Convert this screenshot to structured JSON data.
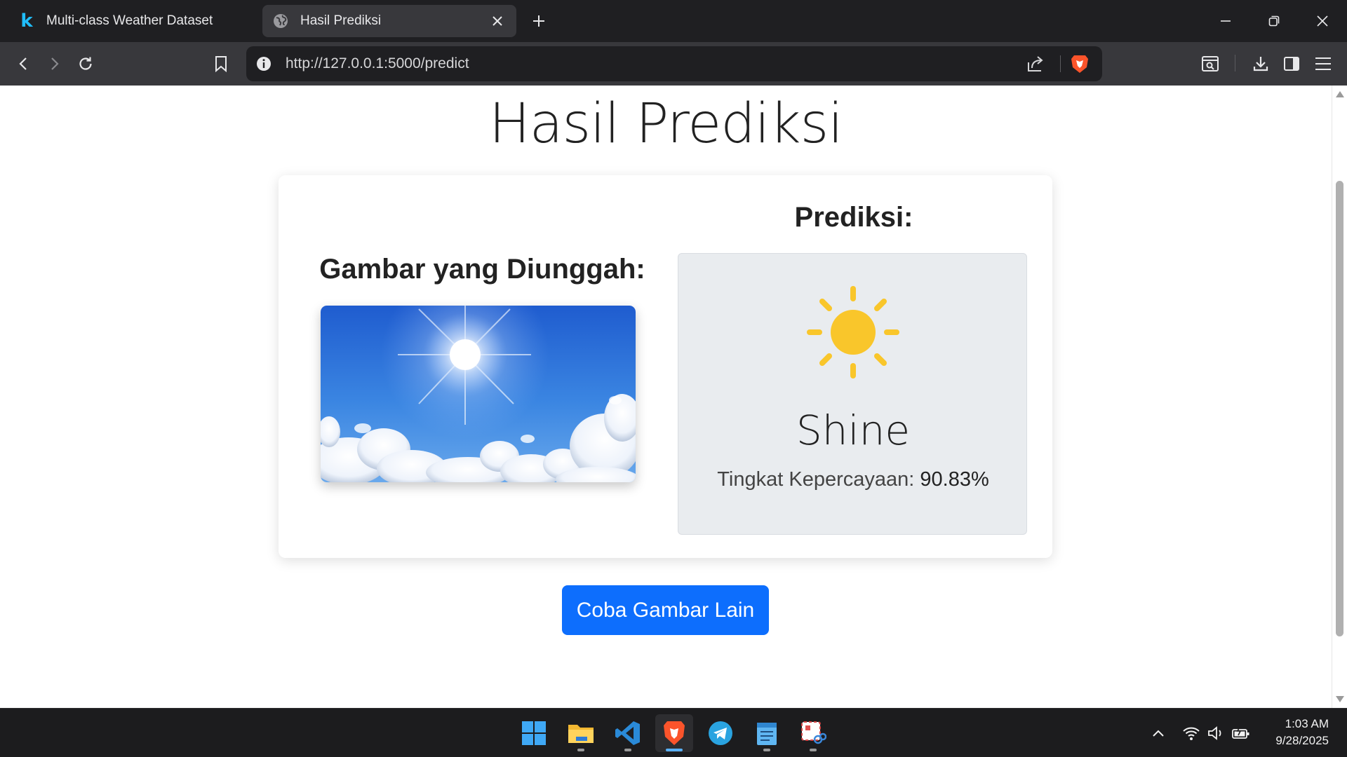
{
  "browser": {
    "tabs": [
      {
        "title": "Multi-class Weather Dataset",
        "icon": "kaggle-icon",
        "active": false
      },
      {
        "title": "Hasil Prediksi",
        "icon": "globe-icon",
        "active": true
      }
    ],
    "url": "http://127.0.0.1:5000/predict"
  },
  "page": {
    "title": "Hasil Prediksi",
    "uploaded_heading": "Gambar yang Diunggah:",
    "prediction_heading": "Prediksi:",
    "prediction_icon": "sun-icon",
    "prediction_label": "Shine",
    "confidence_label": "Tingkat Kepercayaan:",
    "confidence_value": "90.83%",
    "retry_button": "Coba Gambar Lain"
  },
  "colors": {
    "primary_button": "#0d6efd",
    "sun": "#f9c62b",
    "prediction_panel": "#e9ecef"
  },
  "taskbar": {
    "apps": [
      "windows-start",
      "file-explorer",
      "visual-studio-code",
      "brave-browser",
      "telegram",
      "notepad",
      "snipping-tool"
    ],
    "time": "1:03 AM",
    "date": "9/28/2025"
  }
}
